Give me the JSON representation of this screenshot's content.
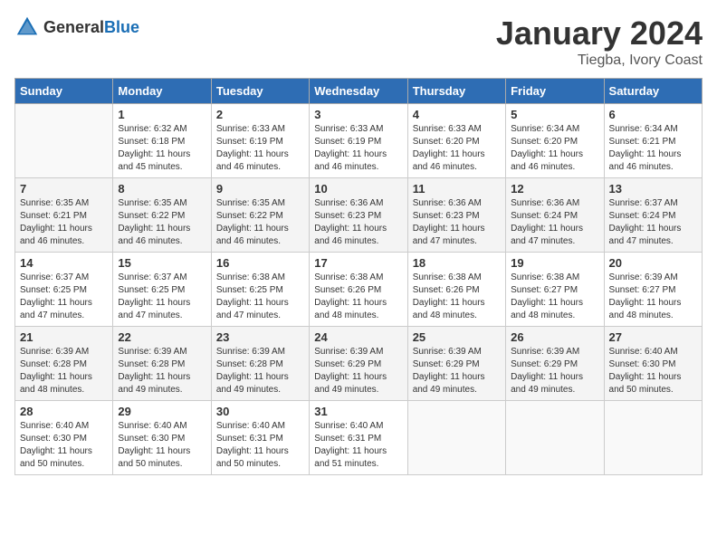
{
  "logo": {
    "text_general": "General",
    "text_blue": "Blue"
  },
  "title": {
    "month": "January 2024",
    "location": "Tiegba, Ivory Coast"
  },
  "weekdays": [
    "Sunday",
    "Monday",
    "Tuesday",
    "Wednesday",
    "Thursday",
    "Friday",
    "Saturday"
  ],
  "weeks": [
    [
      {
        "day": "",
        "empty": true
      },
      {
        "day": "1",
        "sunrise": "Sunrise: 6:32 AM",
        "sunset": "Sunset: 6:18 PM",
        "daylight": "Daylight: 11 hours and 45 minutes."
      },
      {
        "day": "2",
        "sunrise": "Sunrise: 6:33 AM",
        "sunset": "Sunset: 6:19 PM",
        "daylight": "Daylight: 11 hours and 46 minutes."
      },
      {
        "day": "3",
        "sunrise": "Sunrise: 6:33 AM",
        "sunset": "Sunset: 6:19 PM",
        "daylight": "Daylight: 11 hours and 46 minutes."
      },
      {
        "day": "4",
        "sunrise": "Sunrise: 6:33 AM",
        "sunset": "Sunset: 6:20 PM",
        "daylight": "Daylight: 11 hours and 46 minutes."
      },
      {
        "day": "5",
        "sunrise": "Sunrise: 6:34 AM",
        "sunset": "Sunset: 6:20 PM",
        "daylight": "Daylight: 11 hours and 46 minutes."
      },
      {
        "day": "6",
        "sunrise": "Sunrise: 6:34 AM",
        "sunset": "Sunset: 6:21 PM",
        "daylight": "Daylight: 11 hours and 46 minutes."
      }
    ],
    [
      {
        "day": "7",
        "sunrise": "Sunrise: 6:35 AM",
        "sunset": "Sunset: 6:21 PM",
        "daylight": "Daylight: 11 hours and 46 minutes."
      },
      {
        "day": "8",
        "sunrise": "Sunrise: 6:35 AM",
        "sunset": "Sunset: 6:22 PM",
        "daylight": "Daylight: 11 hours and 46 minutes."
      },
      {
        "day": "9",
        "sunrise": "Sunrise: 6:35 AM",
        "sunset": "Sunset: 6:22 PM",
        "daylight": "Daylight: 11 hours and 46 minutes."
      },
      {
        "day": "10",
        "sunrise": "Sunrise: 6:36 AM",
        "sunset": "Sunset: 6:23 PM",
        "daylight": "Daylight: 11 hours and 46 minutes."
      },
      {
        "day": "11",
        "sunrise": "Sunrise: 6:36 AM",
        "sunset": "Sunset: 6:23 PM",
        "daylight": "Daylight: 11 hours and 47 minutes."
      },
      {
        "day": "12",
        "sunrise": "Sunrise: 6:36 AM",
        "sunset": "Sunset: 6:24 PM",
        "daylight": "Daylight: 11 hours and 47 minutes."
      },
      {
        "day": "13",
        "sunrise": "Sunrise: 6:37 AM",
        "sunset": "Sunset: 6:24 PM",
        "daylight": "Daylight: 11 hours and 47 minutes."
      }
    ],
    [
      {
        "day": "14",
        "sunrise": "Sunrise: 6:37 AM",
        "sunset": "Sunset: 6:25 PM",
        "daylight": "Daylight: 11 hours and 47 minutes."
      },
      {
        "day": "15",
        "sunrise": "Sunrise: 6:37 AM",
        "sunset": "Sunset: 6:25 PM",
        "daylight": "Daylight: 11 hours and 47 minutes."
      },
      {
        "day": "16",
        "sunrise": "Sunrise: 6:38 AM",
        "sunset": "Sunset: 6:25 PM",
        "daylight": "Daylight: 11 hours and 47 minutes."
      },
      {
        "day": "17",
        "sunrise": "Sunrise: 6:38 AM",
        "sunset": "Sunset: 6:26 PM",
        "daylight": "Daylight: 11 hours and 48 minutes."
      },
      {
        "day": "18",
        "sunrise": "Sunrise: 6:38 AM",
        "sunset": "Sunset: 6:26 PM",
        "daylight": "Daylight: 11 hours and 48 minutes."
      },
      {
        "day": "19",
        "sunrise": "Sunrise: 6:38 AM",
        "sunset": "Sunset: 6:27 PM",
        "daylight": "Daylight: 11 hours and 48 minutes."
      },
      {
        "day": "20",
        "sunrise": "Sunrise: 6:39 AM",
        "sunset": "Sunset: 6:27 PM",
        "daylight": "Daylight: 11 hours and 48 minutes."
      }
    ],
    [
      {
        "day": "21",
        "sunrise": "Sunrise: 6:39 AM",
        "sunset": "Sunset: 6:28 PM",
        "daylight": "Daylight: 11 hours and 48 minutes."
      },
      {
        "day": "22",
        "sunrise": "Sunrise: 6:39 AM",
        "sunset": "Sunset: 6:28 PM",
        "daylight": "Daylight: 11 hours and 49 minutes."
      },
      {
        "day": "23",
        "sunrise": "Sunrise: 6:39 AM",
        "sunset": "Sunset: 6:28 PM",
        "daylight": "Daylight: 11 hours and 49 minutes."
      },
      {
        "day": "24",
        "sunrise": "Sunrise: 6:39 AM",
        "sunset": "Sunset: 6:29 PM",
        "daylight": "Daylight: 11 hours and 49 minutes."
      },
      {
        "day": "25",
        "sunrise": "Sunrise: 6:39 AM",
        "sunset": "Sunset: 6:29 PM",
        "daylight": "Daylight: 11 hours and 49 minutes."
      },
      {
        "day": "26",
        "sunrise": "Sunrise: 6:39 AM",
        "sunset": "Sunset: 6:29 PM",
        "daylight": "Daylight: 11 hours and 49 minutes."
      },
      {
        "day": "27",
        "sunrise": "Sunrise: 6:40 AM",
        "sunset": "Sunset: 6:30 PM",
        "daylight": "Daylight: 11 hours and 50 minutes."
      }
    ],
    [
      {
        "day": "28",
        "sunrise": "Sunrise: 6:40 AM",
        "sunset": "Sunset: 6:30 PM",
        "daylight": "Daylight: 11 hours and 50 minutes."
      },
      {
        "day": "29",
        "sunrise": "Sunrise: 6:40 AM",
        "sunset": "Sunset: 6:30 PM",
        "daylight": "Daylight: 11 hours and 50 minutes."
      },
      {
        "day": "30",
        "sunrise": "Sunrise: 6:40 AM",
        "sunset": "Sunset: 6:31 PM",
        "daylight": "Daylight: 11 hours and 50 minutes."
      },
      {
        "day": "31",
        "sunrise": "Sunrise: 6:40 AM",
        "sunset": "Sunset: 6:31 PM",
        "daylight": "Daylight: 11 hours and 51 minutes."
      },
      {
        "day": "",
        "empty": true
      },
      {
        "day": "",
        "empty": true
      },
      {
        "day": "",
        "empty": true
      }
    ]
  ]
}
